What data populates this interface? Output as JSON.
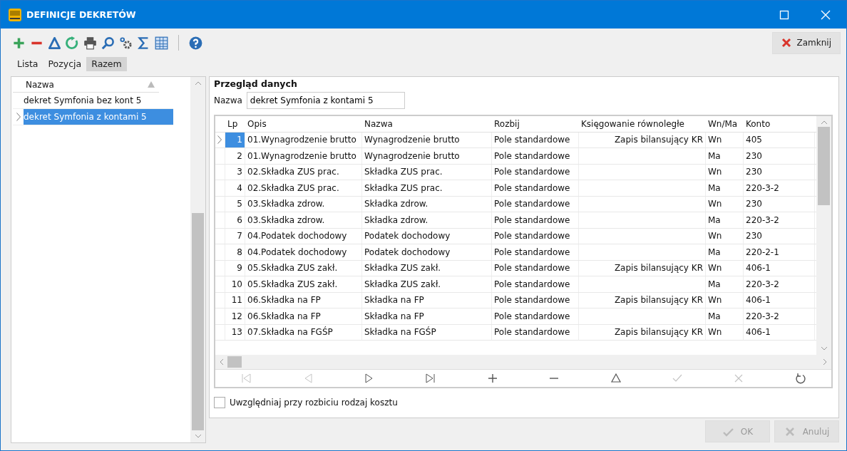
{
  "window": {
    "title": "DEFINICJE DEKRETÓW"
  },
  "toolbar": {
    "tools": [
      {
        "kind": "add"
      },
      {
        "kind": "remove"
      },
      {
        "kind": "edit"
      },
      {
        "kind": "refresh"
      },
      {
        "kind": "print"
      },
      {
        "kind": "search"
      },
      {
        "kind": "settings"
      },
      {
        "kind": "sum"
      },
      {
        "kind": "columns"
      },
      {
        "kind": "separator"
      },
      {
        "kind": "help"
      }
    ],
    "close_button": "Zamknij"
  },
  "tabs": [
    {
      "label": "Lista",
      "selected": false
    },
    {
      "label": "Pozycja",
      "selected": false
    },
    {
      "label": "Razem",
      "selected": true
    }
  ],
  "sidebar": {
    "column": "Nazwa",
    "items": [
      {
        "label": "dekret Symfonia bez kont 5",
        "selected": false
      },
      {
        "label": "dekret Symfonia z kontami 5",
        "selected": true
      }
    ]
  },
  "details": {
    "title": "Przegląd danych",
    "name_label": "Nazwa",
    "name_value": "dekret Symfonia z kontami 5",
    "table": {
      "columns": [
        "Lp",
        "Opis",
        "Nazwa",
        "Rozbij",
        "Księgowanie równoległe",
        "Wn/Ma",
        "Konto"
      ],
      "rows": [
        {
          "cells": [
            "1",
            "01.Wynagrodzenie brutto",
            "Wynagrodzenie brutto",
            "Pole standardowe",
            "Zapis bilansujący KR",
            "Wn",
            "405"
          ],
          "selected": true
        },
        {
          "cells": [
            "2",
            "01.Wynagrodzenie brutto",
            "Wynagrodzenie brutto",
            "Pole standardowe",
            "",
            "Ma",
            "230"
          ],
          "selected": false
        },
        {
          "cells": [
            "3",
            "02.Składka ZUS prac.",
            "Składka ZUS prac.",
            "Pole standardowe",
            "",
            "Wn",
            "230"
          ],
          "selected": false
        },
        {
          "cells": [
            "4",
            "02.Składka ZUS prac.",
            "Składka ZUS prac.",
            "Pole standardowe",
            "",
            "Ma",
            "220-3-2"
          ],
          "selected": false
        },
        {
          "cells": [
            "5",
            "03.Składka zdrow.",
            "Składka zdrow.",
            "Pole standardowe",
            "",
            "Wn",
            "230"
          ],
          "selected": false
        },
        {
          "cells": [
            "6",
            "03.Składka zdrow.",
            "Składka zdrow.",
            "Pole standardowe",
            "",
            "Ma",
            "220-3-2"
          ],
          "selected": false
        },
        {
          "cells": [
            "7",
            "04.Podatek dochodowy",
            "Podatek dochodowy",
            "Pole standardowe",
            "",
            "Wn",
            "230"
          ],
          "selected": false
        },
        {
          "cells": [
            "8",
            "04.Podatek dochodowy",
            "Podatek dochodowy",
            "Pole standardowe",
            "",
            "Ma",
            "220-2-1"
          ],
          "selected": false
        },
        {
          "cells": [
            "9",
            "05.Składka ZUS zakł.",
            "Składka ZUS zakł.",
            "Pole standardowe",
            "Zapis bilansujący KR",
            "Wn",
            "406-1"
          ],
          "selected": false
        },
        {
          "cells": [
            "10",
            "05.Składka ZUS zakł.",
            "Składka ZUS zakł.",
            "Pole standardowe",
            "",
            "Ma",
            "220-3-2"
          ],
          "selected": false
        },
        {
          "cells": [
            "11",
            "06.Składka na FP",
            "Składka na FP",
            "Pole standardowe",
            "Zapis bilansujący KR",
            "Wn",
            "406-1"
          ],
          "selected": false
        },
        {
          "cells": [
            "12",
            "06.Składka na FP",
            "Składka na FP",
            "Pole standardowe",
            "",
            "Ma",
            "220-3-2"
          ],
          "selected": false
        },
        {
          "cells": [
            "13",
            "07.Składka na FGŚP",
            "Składka na FGŚP",
            "Pole standardowe",
            "Zapis bilansujący KR",
            "Wn",
            "406-1"
          ],
          "selected": false
        }
      ]
    },
    "navigator": [
      {
        "kind": "first",
        "disabled": true
      },
      {
        "kind": "prev",
        "disabled": true
      },
      {
        "kind": "next",
        "disabled": false
      },
      {
        "kind": "last",
        "disabled": false
      },
      {
        "kind": "add",
        "disabled": false
      },
      {
        "kind": "remove",
        "disabled": false
      },
      {
        "kind": "edit",
        "disabled": false
      },
      {
        "kind": "confirm",
        "disabled": true
      },
      {
        "kind": "cancel",
        "disabled": true
      },
      {
        "kind": "refresh",
        "disabled": false
      }
    ],
    "checkbox": {
      "label": "Uwzględniaj przy rozbiciu rodzaj kosztu",
      "checked": false
    }
  },
  "buttons": [
    {
      "kind": "ok",
      "label": "OK",
      "disabled": true
    },
    {
      "kind": "cancel",
      "label": "Anuluj",
      "disabled": true
    }
  ]
}
